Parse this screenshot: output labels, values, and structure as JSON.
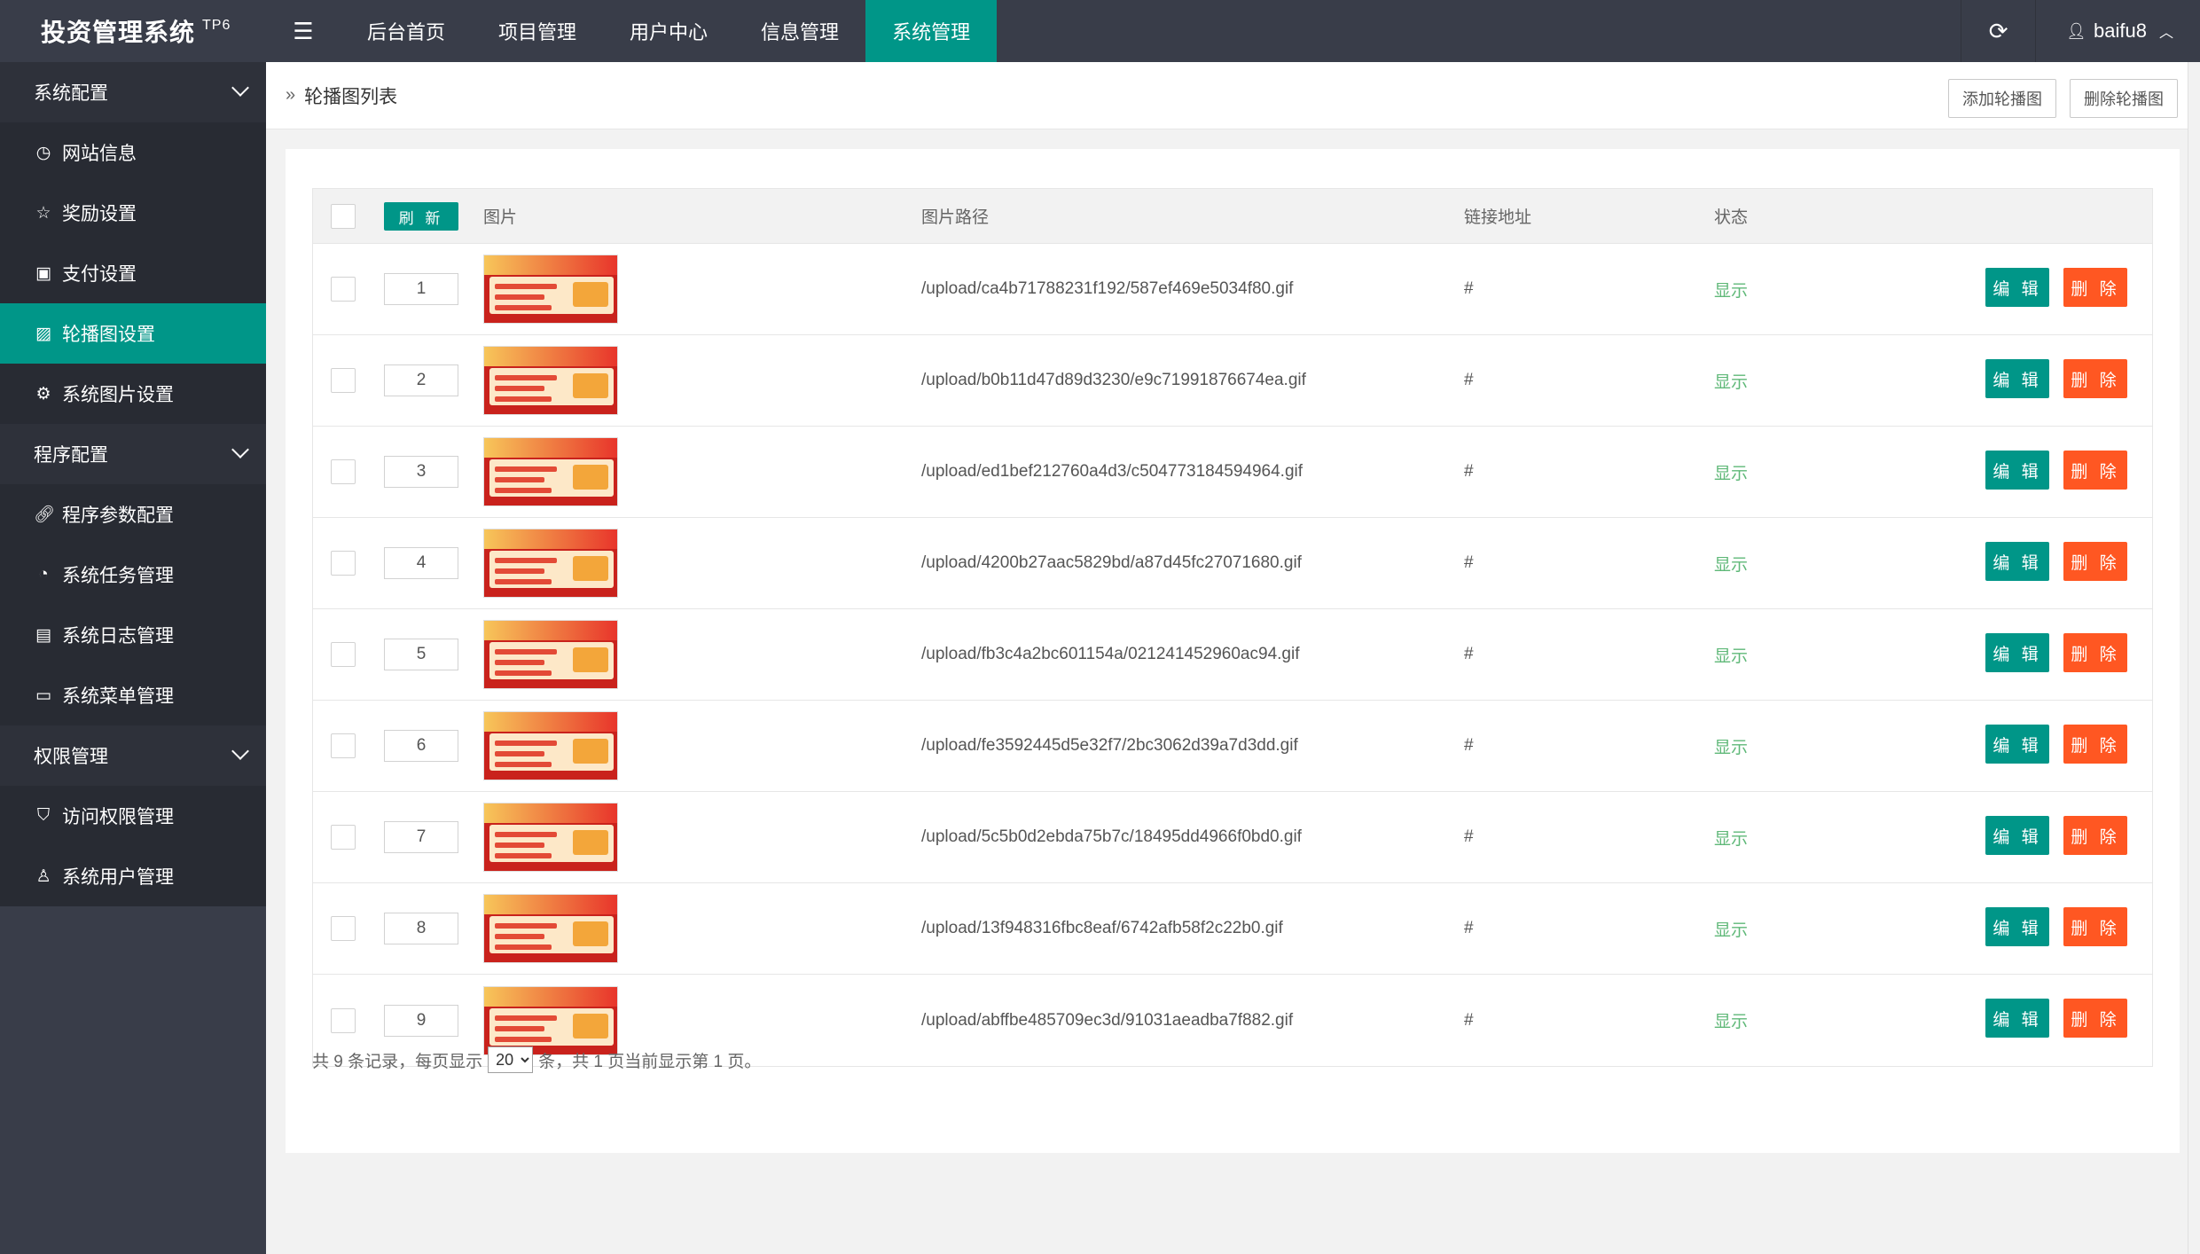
{
  "app": {
    "title": "投资管理系统",
    "version_tag": "TP6"
  },
  "topnav": {
    "items": [
      {
        "label": "后台首页"
      },
      {
        "label": "项目管理"
      },
      {
        "label": "用户中心"
      },
      {
        "label": "信息管理"
      },
      {
        "label": "系统管理",
        "active": true
      }
    ],
    "username": "baifu8"
  },
  "sidebar": {
    "groups": [
      {
        "title": "系统配置",
        "items": [
          {
            "label": "网站信息",
            "icon": "dashboard-icon"
          },
          {
            "label": "奖励设置",
            "icon": "star-icon"
          },
          {
            "label": "支付设置",
            "icon": "money-icon"
          },
          {
            "label": "轮播图设置",
            "icon": "image-icon",
            "active": true
          },
          {
            "label": "系统图片设置",
            "icon": "gear-icon"
          }
        ]
      },
      {
        "title": "程序配置",
        "items": [
          {
            "label": "程序参数配置",
            "icon": "link-icon"
          },
          {
            "label": "系统任务管理",
            "icon": "clock-icon"
          },
          {
            "label": "系统日志管理",
            "icon": "clipboard-icon"
          },
          {
            "label": "系统菜单管理",
            "icon": "menu-card-icon"
          }
        ]
      },
      {
        "title": "权限管理",
        "items": [
          {
            "label": "访问权限管理",
            "icon": "shield-icon"
          },
          {
            "label": "系统用户管理",
            "icon": "user-icon"
          }
        ]
      }
    ]
  },
  "breadcrumb": {
    "title": "轮播图列表"
  },
  "actions": {
    "add": "添加轮播图",
    "delete": "删除轮播图"
  },
  "table": {
    "refresh_label": "刷 新",
    "headers": {
      "image": "图片",
      "path": "图片路径",
      "link": "链接地址",
      "status": "状态"
    },
    "edit_label": "编 辑",
    "delete_label": "删 除",
    "rows": [
      {
        "sort": "1",
        "path": "/upload/ca4b71788231f192/587ef469e5034f80.gif",
        "link": "#",
        "status": "显示"
      },
      {
        "sort": "2",
        "path": "/upload/b0b11d47d89d3230/e9c71991876674ea.gif",
        "link": "#",
        "status": "显示"
      },
      {
        "sort": "3",
        "path": "/upload/ed1bef212760a4d3/c504773184594964.gif",
        "link": "#",
        "status": "显示"
      },
      {
        "sort": "4",
        "path": "/upload/4200b27aac5829bd/a87d45fc27071680.gif",
        "link": "#",
        "status": "显示"
      },
      {
        "sort": "5",
        "path": "/upload/fb3c4a2bc601154a/021241452960ac94.gif",
        "link": "#",
        "status": "显示"
      },
      {
        "sort": "6",
        "path": "/upload/fe3592445d5e32f7/2bc3062d39a7d3dd.gif",
        "link": "#",
        "status": "显示"
      },
      {
        "sort": "7",
        "path": "/upload/5c5b0d2ebda75b7c/18495dd4966f0bd0.gif",
        "link": "#",
        "status": "显示"
      },
      {
        "sort": "8",
        "path": "/upload/13f948316fbc8eaf/6742afb58f2c22b0.gif",
        "link": "#",
        "status": "显示"
      },
      {
        "sort": "9",
        "path": "/upload/abffbe485709ec3d/91031aeadba7f882.gif",
        "link": "#",
        "status": "显示"
      }
    ]
  },
  "pager": {
    "prefix": "共 9 条记录，每页显示",
    "per_page": "20",
    "suffix": "条，共 1 页当前显示第 1 页。"
  },
  "colors": {
    "header_bg": "#393d49",
    "accent": "#009688",
    "danger": "#ff5722",
    "status_green": "#5fb878"
  }
}
